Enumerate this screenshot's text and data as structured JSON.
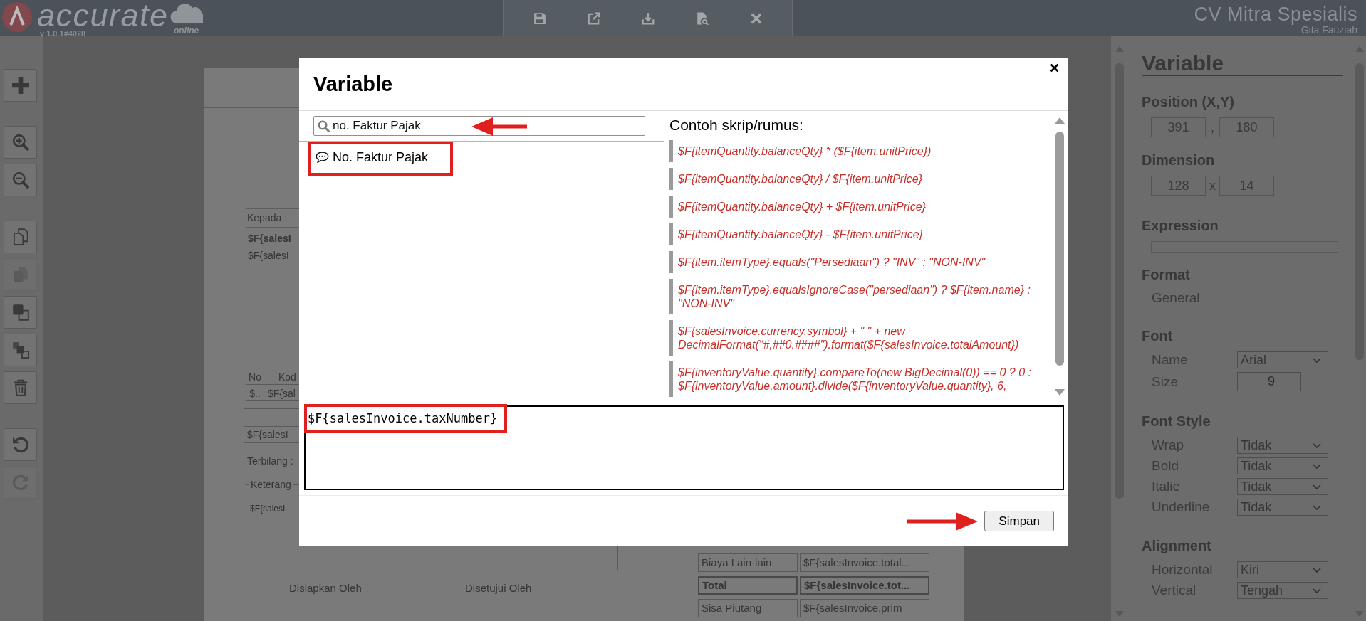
{
  "app_bar": {
    "logo": "accurate",
    "version": "v 1.0.1#4028",
    "logo_tag": "online",
    "company": "CV Mitra Spesialis",
    "user": "Gita Fauziah"
  },
  "sidebar": {
    "groups": [
      {
        "tools": [
          {
            "kind": "add",
            "disabled": false
          }
        ]
      },
      {
        "tools": [
          {
            "kind": "zoom_in",
            "disabled": false
          },
          {
            "kind": "zoom_out",
            "disabled": false
          }
        ]
      },
      {
        "tools": [
          {
            "kind": "copy",
            "disabled": false
          },
          {
            "kind": "paste",
            "disabled": true
          },
          {
            "kind": "bring_front",
            "disabled": false
          },
          {
            "kind": "send_back",
            "disabled": false
          },
          {
            "kind": "delete",
            "disabled": false
          }
        ]
      },
      {
        "tools": [
          {
            "kind": "undo",
            "disabled": false
          },
          {
            "kind": "redo",
            "disabled": true
          }
        ]
      }
    ]
  },
  "document": {
    "recipient_label": "Kepada :",
    "customer_name": "$F{salesI",
    "customer_address": "$F{salesI",
    "items_table": {
      "columns": [
        "No",
        "Kod"
      ],
      "rows": [
        [
          "$..",
          "$F{sal"
        ]
      ]
    },
    "amount": "$F{salesI",
    "amount_words_label": "Terbilang :",
    "notes": {
      "legend": "Keterang",
      "value": "$F{salesI"
    },
    "signatures": [
      "Disiapkan Oleh",
      "Disetujui Oleh"
    ],
    "summary": [
      {
        "kind": "normal",
        "label": "Biaya Lain-lain",
        "value": "$F{salesInvoice.total..."
      },
      {
        "kind": "total",
        "label": "Total",
        "value": "$F{salesInvoice.tot..."
      },
      {
        "kind": "normal",
        "label": "Sisa Piutang",
        "value": "$F{salesInvoice.prim"
      }
    ]
  },
  "dialog": {
    "title": "Variable",
    "search": {
      "value": "no. Faktur Pajak"
    },
    "results": [
      {
        "label": "No. Faktur Pajak"
      }
    ],
    "examples_title": "Contoh skrip/rumus:",
    "examples": [
      "$F{itemQuantity.balanceQty} * ($F{item.unitPrice})",
      "$F{itemQuantity.balanceQty} / $F{item.unitPrice}",
      "$F{itemQuantity.balanceQty} + $F{item.unitPrice}",
      "$F{itemQuantity.balanceQty} - $F{item.unitPrice}",
      "$F{item.itemType}.equals(\"Persediaan\") ? \"INV\" : \"NON-INV\"",
      "$F{item.itemType}.equalsIgnoreCase(\"persediaan\") ? $F{item.name} : \"NON-INV\"",
      "$F{salesInvoice.currency.symbol} + \" \" + new DecimalFormat(\"#,##0.####\").format($F{salesInvoice.totalAmount})",
      "$F{inventoryValue.quantity}.compareTo(new BigDecimal(0)) == 0 ? 0 : $F{inventoryValue.amount}.divide($F{inventoryValue.quantity}, 6,"
    ],
    "expression": "$F{salesInvoice.taxNumber}",
    "save_button": "Simpan"
  },
  "properties": {
    "title": "Variable",
    "sections": [
      {
        "kind": "pair",
        "title": "Position (X,Y)",
        "first": "391",
        "separator": ",",
        "second": "180"
      },
      {
        "kind": "pair",
        "title": "Dimension",
        "first": "128",
        "separator": "x",
        "second": "14"
      },
      {
        "kind": "field",
        "title": "Expression"
      },
      {
        "kind": "text",
        "title": "Format",
        "value": "General"
      },
      {
        "kind": "rows",
        "title": "Font",
        "rows": [
          {
            "kind": "select",
            "label": "Name",
            "value": "Arial"
          },
          {
            "kind": "input",
            "label": "Size",
            "value": "9"
          }
        ]
      },
      {
        "kind": "rows",
        "title": "Font Style",
        "rows": [
          {
            "kind": "select",
            "label": "Wrap",
            "value": "Tidak"
          },
          {
            "kind": "select",
            "label": "Bold",
            "value": "Tidak"
          },
          {
            "kind": "select",
            "label": "Italic",
            "value": "Tidak"
          },
          {
            "kind": "select",
            "label": "Underline",
            "value": "Tidak"
          }
        ]
      },
      {
        "kind": "rows",
        "title": "Alignment",
        "rows": [
          {
            "kind": "select",
            "label": "Horizontal",
            "value": "Kiri"
          },
          {
            "kind": "select",
            "label": "Vertical",
            "value": "Tengah"
          }
        ]
      }
    ]
  }
}
